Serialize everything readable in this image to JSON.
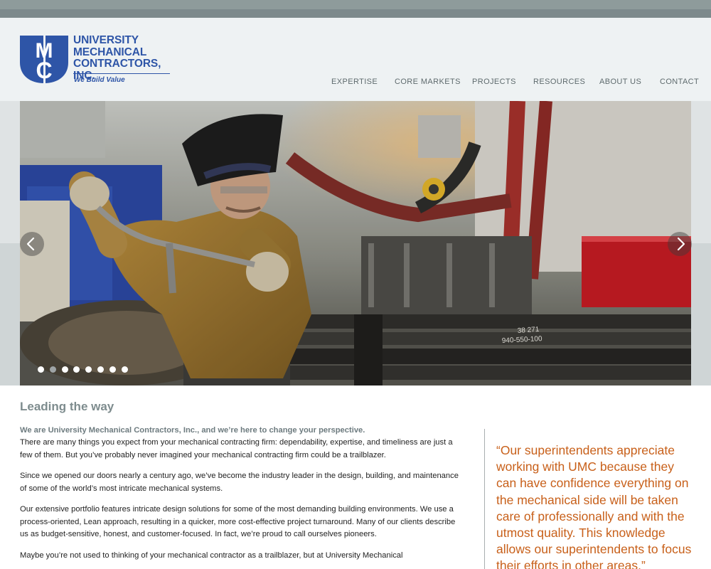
{
  "logo": {
    "letters": "MC",
    "name_lines": [
      "UNIVERSITY",
      "MECHANICAL",
      "CONTRACTORS, INC."
    ],
    "tagline": "We Build Value"
  },
  "nav": {
    "items": [
      {
        "label": "EXPERTISE"
      },
      {
        "label": "CORE MARKETS"
      },
      {
        "label": "PROJECTS"
      },
      {
        "label": "RESOURCES"
      },
      {
        "label": "ABOUT US"
      },
      {
        "label": "CONTACT"
      }
    ]
  },
  "carousel": {
    "slide_count": 8,
    "active_slide": 1,
    "photo_markings": [
      "38 271",
      "940-550-100"
    ]
  },
  "main": {
    "heading": "Leading the way",
    "lead": "We are University Mechanical Contractors, Inc., and we’re here to change your perspective.",
    "paragraphs": [
      "There are many things you expect from your mechanical contracting firm: dependability, expertise, and timeliness are just a few of them. But you’ve probably never imagined your mechanical contracting firm could be a trailblazer.",
      "Since we opened our doors nearly a century ago, we’ve become the industry leader in the design, building, and maintenance of some of the world’s most intricate mechanical systems.",
      "Our extensive portfolio features intricate design solutions for some of the most demanding building environments. We use a process-oriented, Lean approach, resulting in a quicker, more cost-effective project turnaround. Many of our clients describe us as budget-sensitive, honest, and customer-focused. In fact, we’re proud to call ourselves pioneers.",
      "Maybe you’re not used to thinking of your mechanical contractor as a trailblazer, but at University Mechanical"
    ]
  },
  "quote": {
    "text": "“Our superintendents appreciate working with UMC because they can have confidence everything on the mechanical side will be taken care of professionally and with the utmost quality.  This knowledge allows our superintendents to focus their efforts in other areas.”"
  },
  "colors": {
    "brand_blue": "#2e55a7",
    "quote_orange": "#c8601a",
    "heading_gray": "#7e8c8e"
  }
}
